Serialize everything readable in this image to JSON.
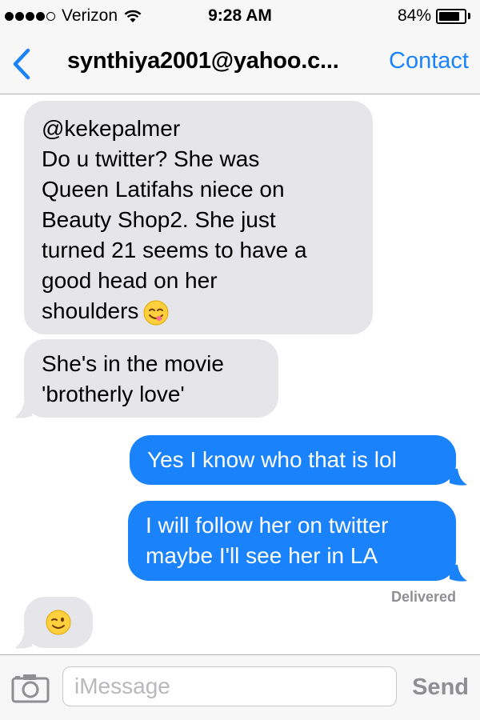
{
  "status_bar": {
    "carrier": "Verizon",
    "signal_bars": 4,
    "signal_total": 5,
    "time": "9:28 AM",
    "battery_percent": "84%",
    "battery_level": 0.84
  },
  "nav": {
    "title": "synthiya2001@yahoo.c...",
    "contact_label": "Contact",
    "back_icon": "chevron-left-icon"
  },
  "messages": [
    {
      "direction": "incoming",
      "lines": [
        "@kekepalmer",
        "Do u twitter? She was",
        "Queen Latifahs niece on",
        "Beauty Shop2. She just",
        "turned 21 seems to have a",
        "good head on her",
        "shoulders"
      ],
      "emoji": "yum-face-emoji"
    },
    {
      "direction": "incoming",
      "lines": [
        "She's in the movie",
        "'brotherly love'"
      ]
    },
    {
      "direction": "outgoing",
      "lines": [
        "Yes I know who that is lol"
      ]
    },
    {
      "direction": "outgoing",
      "lines": [
        "I will follow her on twitter",
        "maybe I'll see her in LA"
      ]
    },
    {
      "direction": "incoming",
      "emoji": "winking-face-emoji"
    }
  ],
  "delivered_label": "Delivered",
  "input_bar": {
    "placeholder": "iMessage",
    "value": "",
    "send_label": "Send",
    "camera_icon": "camera-icon"
  },
  "colors": {
    "accent": "#1a82fb",
    "incoming_bubble": "#e5e5ea",
    "outgoing_bubble": "#1a82fb",
    "bar_background": "#f7f7f7"
  }
}
